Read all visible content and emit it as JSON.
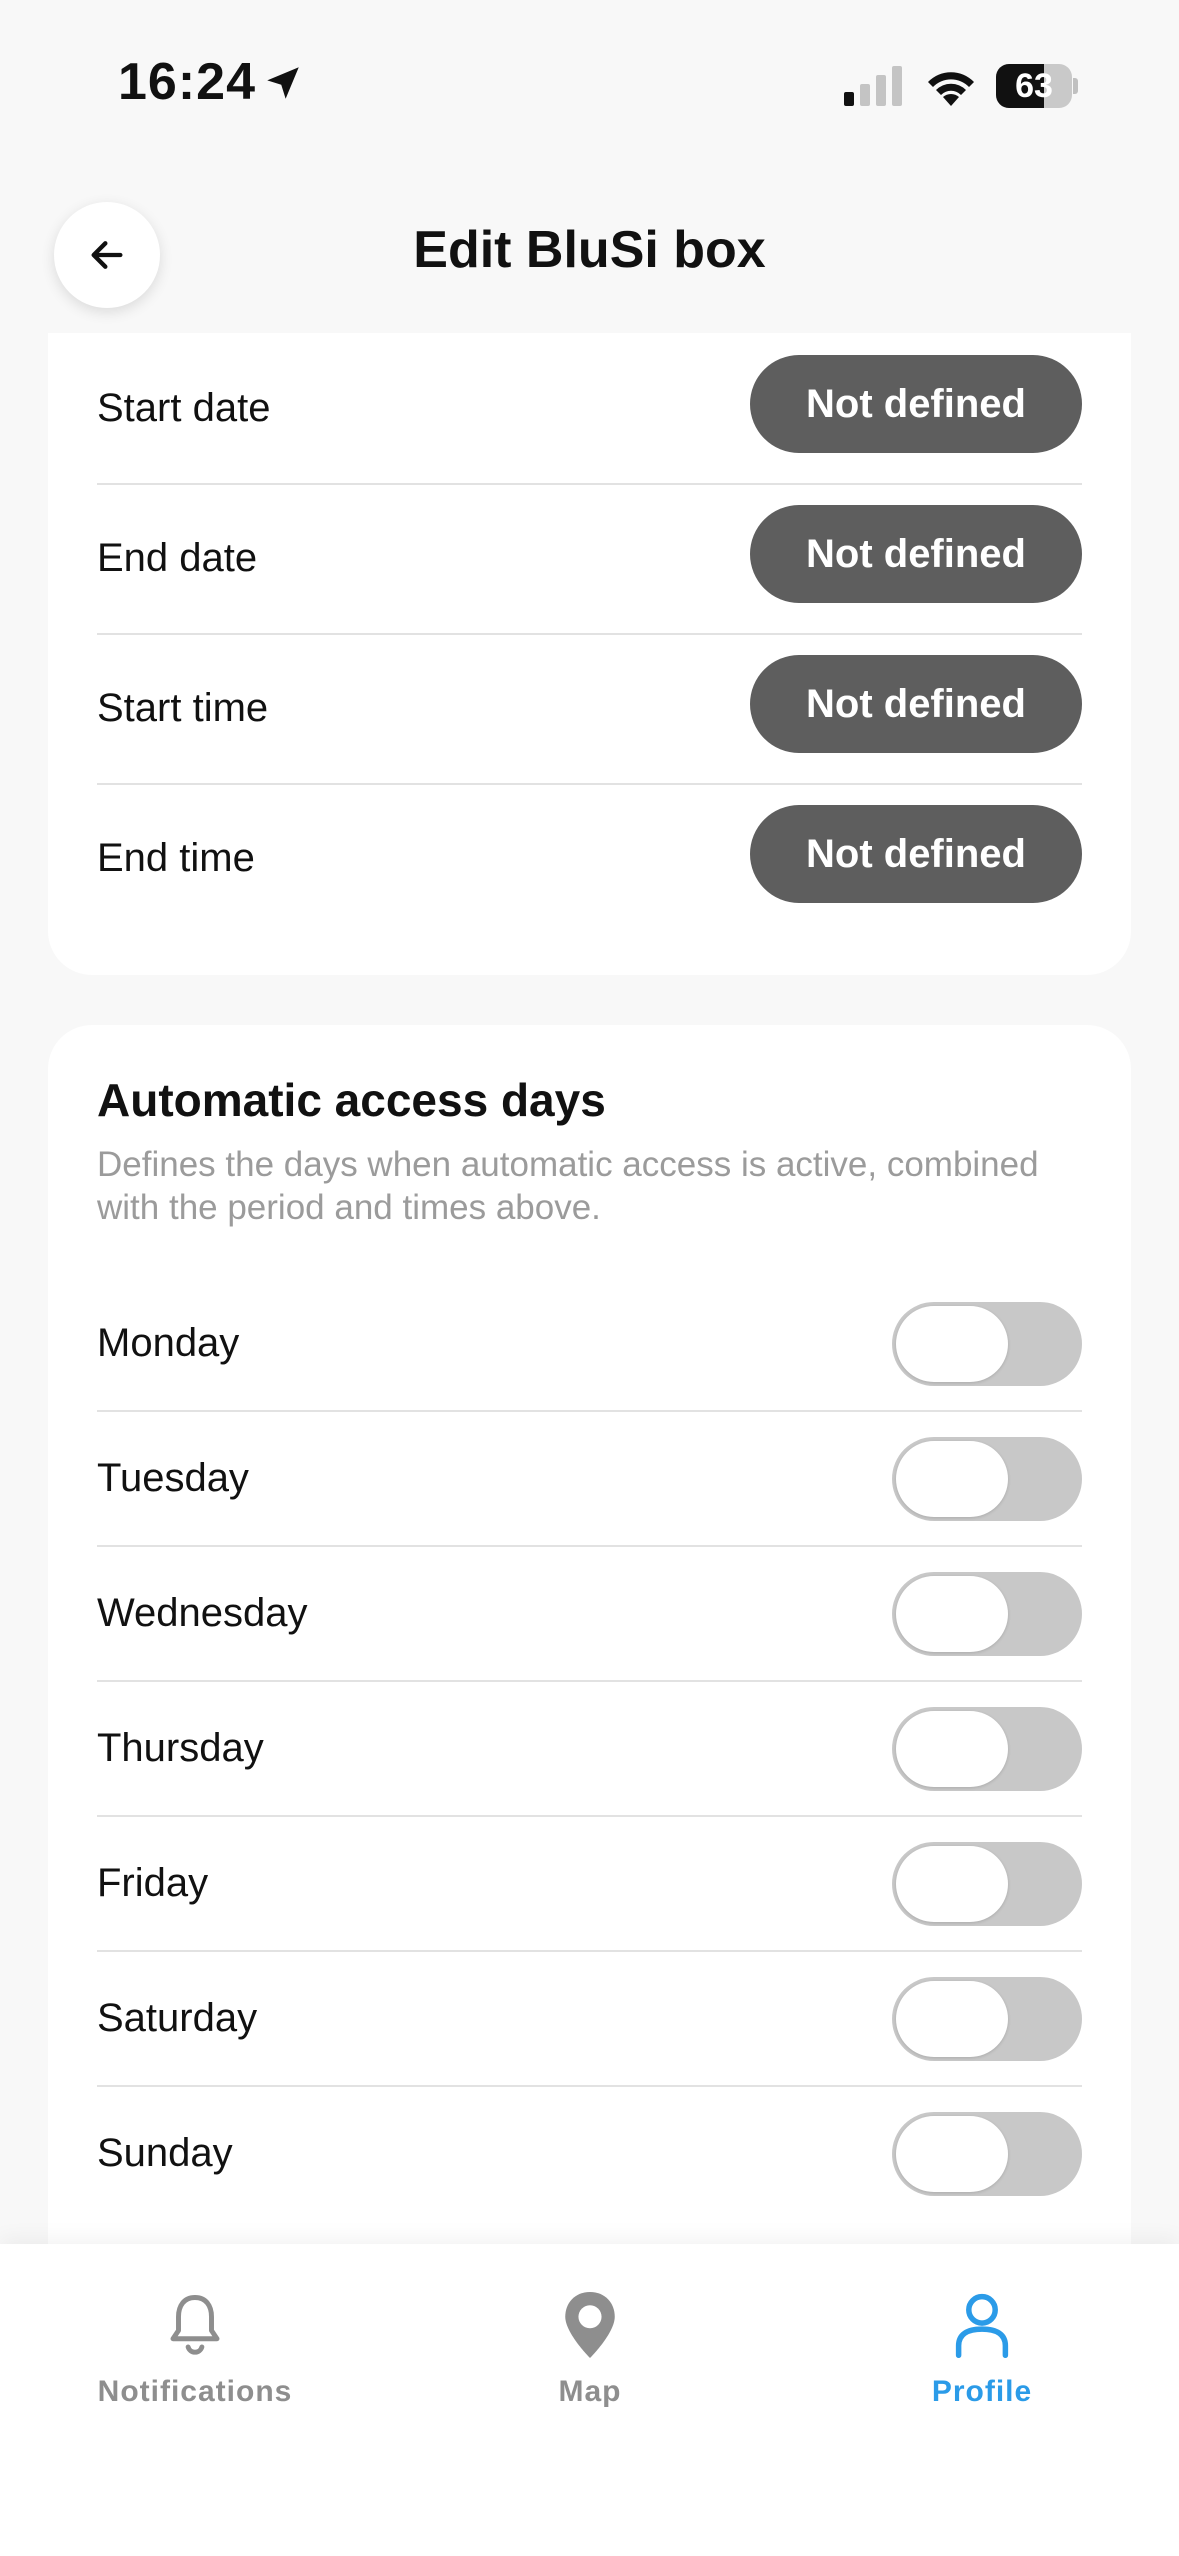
{
  "status_bar": {
    "time": "16:24",
    "battery": "63",
    "battery_level": 0.63
  },
  "header": {
    "title": "Edit BluSi box"
  },
  "schedule": {
    "rows": [
      {
        "label": "Start date",
        "value": "Not defined"
      },
      {
        "label": "End date",
        "value": "Not defined"
      },
      {
        "label": "Start time",
        "value": "Not defined"
      },
      {
        "label": "End time",
        "value": "Not defined"
      }
    ]
  },
  "access_days": {
    "title": "Automatic access days",
    "description": "Defines the days when automatic access is active, combined with the period and times above.",
    "days": [
      {
        "label": "Monday",
        "enabled": false
      },
      {
        "label": "Tuesday",
        "enabled": false
      },
      {
        "label": "Wednesday",
        "enabled": false
      },
      {
        "label": "Thursday",
        "enabled": false
      },
      {
        "label": "Friday",
        "enabled": false
      },
      {
        "label": "Saturday",
        "enabled": false
      },
      {
        "label": "Sunday",
        "enabled": false
      }
    ]
  },
  "tabs": [
    {
      "label": "Notifications",
      "icon": "bell-icon",
      "active": false
    },
    {
      "label": "Map",
      "icon": "map-pin-icon",
      "active": false
    },
    {
      "label": "Profile",
      "icon": "user-icon",
      "active": true
    }
  ],
  "colors": {
    "accent": "#2b9be8",
    "pill": "#5e5e5e",
    "toggle_off": "#c8c8c8",
    "inactive_tab": "#8e8e8e"
  }
}
